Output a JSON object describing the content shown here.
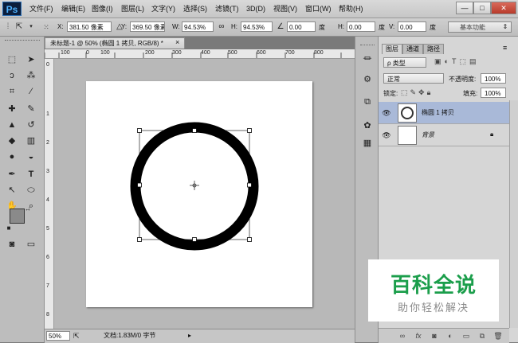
{
  "app": {
    "logo": "Ps"
  },
  "menu": [
    "文件(F)",
    "编辑(E)",
    "图像(I)",
    "图层(L)",
    "文字(Y)",
    "选择(S)",
    "滤镜(T)",
    "3D(D)",
    "视图(V)",
    "窗口(W)",
    "帮助(H)"
  ],
  "window_buttons": {
    "minimize": "—",
    "restore": "□",
    "close": "✕"
  },
  "options": {
    "x_label": "X:",
    "x_value": "381.50 像素",
    "y_label": "Y:",
    "y_value": "369.50 像素",
    "w_label": "W:",
    "w_value": "94.53%",
    "h_label": "H:",
    "h_value": "94.53%",
    "angle_value": "0.00",
    "angle_unit": "度",
    "hskew_label": "H:",
    "hskew_value": "0.00",
    "hskew_unit": "度",
    "vskew_label": "V:",
    "vskew_value": "0.00",
    "vskew_unit": "度",
    "workspace": "基本功能"
  },
  "document": {
    "tab_title": "未标题-1 @ 50% (椭圆 1 拷贝, RGB/8) *",
    "close": "×",
    "ruler_top": [
      "100",
      "0",
      "100",
      "200",
      "300",
      "400",
      "500",
      "600",
      "700",
      "800"
    ],
    "ruler_left": [
      "0",
      "1",
      "2",
      "3",
      "4",
      "5",
      "6",
      "7",
      "8"
    ],
    "zoom": "50%",
    "doc_info": "文档:1.83M/0 字节"
  },
  "layers_panel": {
    "tabs": [
      "图层",
      "通道",
      "路径"
    ],
    "filter_kind": "ρ 类型",
    "blend_mode": "正常",
    "opacity_label": "不透明度:",
    "opacity_value": "100%",
    "lock_label": "锁定:",
    "fill_label": "填充:",
    "fill_value": "100%",
    "layers": [
      {
        "name": "椭圆 1 拷贝",
        "selected": true
      },
      {
        "name": "背景",
        "selected": false
      }
    ]
  },
  "watermark": {
    "title": "百科全说",
    "subtitle": "助你轻松解决"
  },
  "colors": {
    "selected_layer": "#a9b9d8",
    "watermark_green": "#1b9e4b"
  }
}
